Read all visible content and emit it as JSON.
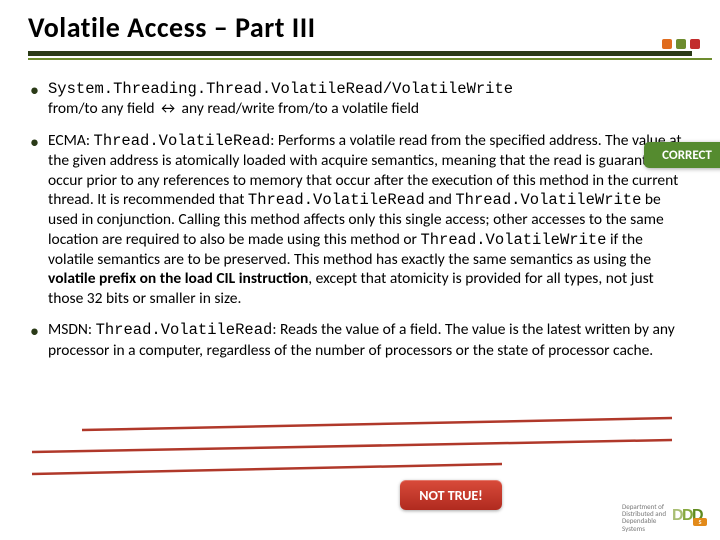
{
  "title": "Volatile Access – Part III",
  "bullets": [
    {
      "line1_pre": "System.Threading.Thread.VolatileRead/VolatileWrite",
      "line2": "from/to any field ↔ any read/write from/to a volatile field"
    },
    {
      "ecma_label": "ECMA: ",
      "ecma_code": "Thread.VolatileRead",
      "ecma_rest": ": Performs a volatile read from the specified address. The value at the given address is atomically loaded with acquire semantics, meaning that the read is guaranteed to occur prior to any references to memory that occur after the execution of this method in the current thread. It is recommended that ",
      "ecma_code2": "Thread.VolatileRead",
      "ecma_and": " and ",
      "ecma_code3": "Thread.VolatileWrite",
      "ecma_rest2": " be used in conjunction. Calling this method affects only this single access; other accesses to the same location are required to also be made using this method or ",
      "ecma_code4": "Thread.VolatileWrite",
      "ecma_rest3": " if the volatile semantics are to be preserved. This method has exactly the same semantics as using the ",
      "ecma_bold": "volatile prefix on the load CIL instruction",
      "ecma_rest4": ", except that atomicity is provided for all types, not just those 32 bits or smaller in size."
    },
    {
      "msdn_label": "MSDN: ",
      "msdn_code": "Thread.VolatileRead",
      "msdn_rest": ": Reads the value of a field. The value is the latest written by any processor in a computer, regardless of the number of processors or the state of processor cache."
    }
  ],
  "badges": {
    "correct": "CORRECT",
    "not_true": "NOT TRUE!"
  },
  "footer": {
    "line1": "Department of",
    "line2": "Distributed and",
    "line3": "Dependable",
    "line4": "Systems",
    "logo_s": "S"
  }
}
